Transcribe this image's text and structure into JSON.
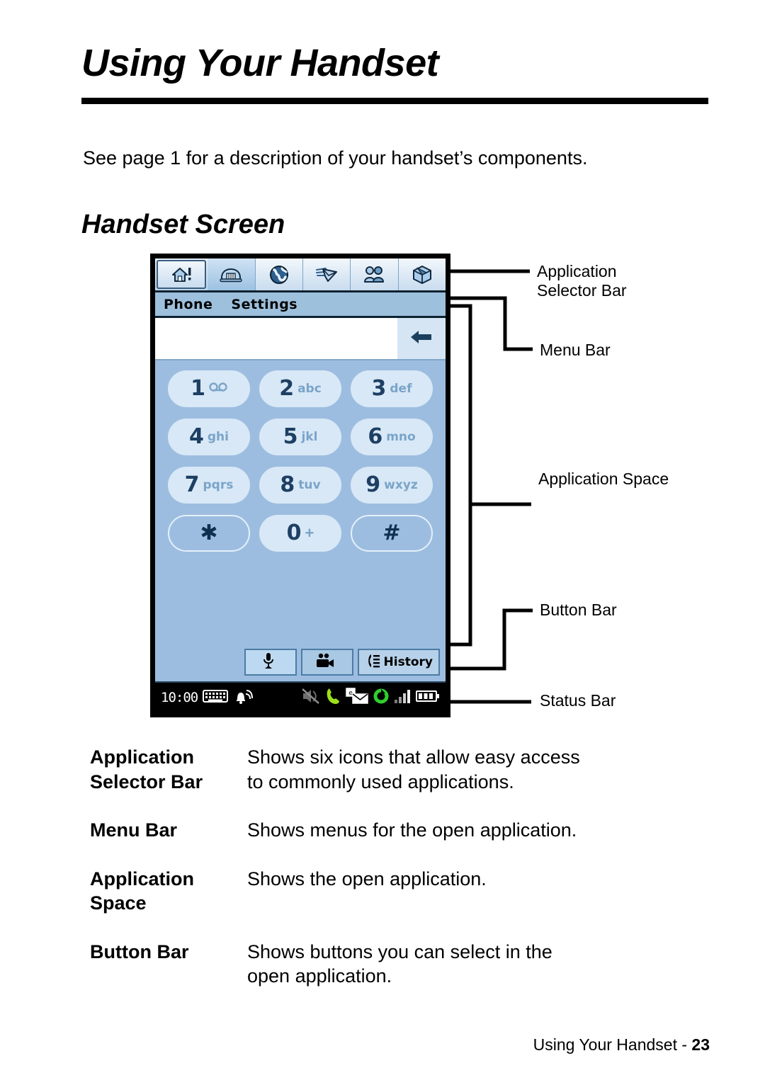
{
  "document": {
    "title": "Using Your Handset",
    "intro": "See page 1 for a description of your handset’s components.",
    "section_title": "Handset Screen",
    "footer_text": "Using Your Handset - ",
    "footer_page": "23"
  },
  "handset": {
    "app_selector": {
      "icons": [
        {
          "name": "home-alert-icon",
          "label": "Home"
        },
        {
          "name": "phone-icon",
          "label": "Phone",
          "selected": true
        },
        {
          "name": "globe-icon",
          "label": "Browser"
        },
        {
          "name": "winged-envelope-icon",
          "label": "Messaging"
        },
        {
          "name": "contacts-icon",
          "label": "Contacts"
        },
        {
          "name": "box-icon",
          "label": "Applications"
        }
      ]
    },
    "menu_bar": {
      "items": [
        "Phone",
        "Settings"
      ]
    },
    "input_row": {
      "value": "",
      "backspace_icon": "backspace-arrow-icon"
    },
    "keypad": {
      "rows": [
        [
          {
            "digit": "1",
            "letters": "",
            "symbol": "voicemail"
          },
          {
            "digit": "2",
            "letters": "abc"
          },
          {
            "digit": "3",
            "letters": "def"
          }
        ],
        [
          {
            "digit": "4",
            "letters": "ghi"
          },
          {
            "digit": "5",
            "letters": "jkl"
          },
          {
            "digit": "6",
            "letters": "mno"
          }
        ],
        [
          {
            "digit": "7",
            "letters": "pqrs"
          },
          {
            "digit": "8",
            "letters": "tuv"
          },
          {
            "digit": "9",
            "letters": "wxyz"
          }
        ],
        [
          {
            "digit": "✱",
            "letters": "",
            "style": "outline"
          },
          {
            "digit": "0",
            "letters": "+"
          },
          {
            "digit": "#",
            "letters": "",
            "style": "outline"
          }
        ]
      ]
    },
    "button_bar": {
      "buttons": [
        {
          "name": "microphone-button",
          "icon": "microphone-icon",
          "label": "",
          "selected": true
        },
        {
          "name": "video-call-button",
          "icon": "video-camera-icon",
          "label": ""
        },
        {
          "name": "history-button",
          "icon": "call-history-icon",
          "label": "History"
        }
      ]
    },
    "status_bar": {
      "time": "10:00",
      "icons": [
        "keyboard-icon",
        "alert-bell-icon",
        "mute-icon",
        "phone-active-icon",
        "message-icon",
        "sync-icon",
        "signal-bars-icon",
        "battery-icon"
      ]
    }
  },
  "callouts": [
    {
      "name": "callout-application-selector-bar",
      "label": "Application\nSelector Bar"
    },
    {
      "name": "callout-menu-bar",
      "label": "Menu Bar"
    },
    {
      "name": "callout-application-space",
      "label": "Application Space"
    },
    {
      "name": "callout-button-bar",
      "label": "Button Bar"
    },
    {
      "name": "callout-status-bar",
      "label": "Status Bar"
    }
  ],
  "definitions": [
    {
      "term": "Application\nSelector Bar",
      "desc": "Shows six icons that allow easy access\nto commonly used applications."
    },
    {
      "term": "Menu Bar",
      "desc": "Shows menus for the open application."
    },
    {
      "term": "Application\nSpace",
      "desc": "Shows the open application."
    },
    {
      "term": "Button Bar",
      "desc": "Shows buttons you can select in the\nopen application."
    }
  ],
  "colors": {
    "screen_bg": "#9dbde0",
    "menu_bar": "#9dc0dd",
    "key_fill": "#d8e8f6",
    "key_digit": "#1d3f63",
    "key_letters": "#7aa4c9",
    "status_bg": "#000000",
    "accent_green": "#7fe000"
  }
}
